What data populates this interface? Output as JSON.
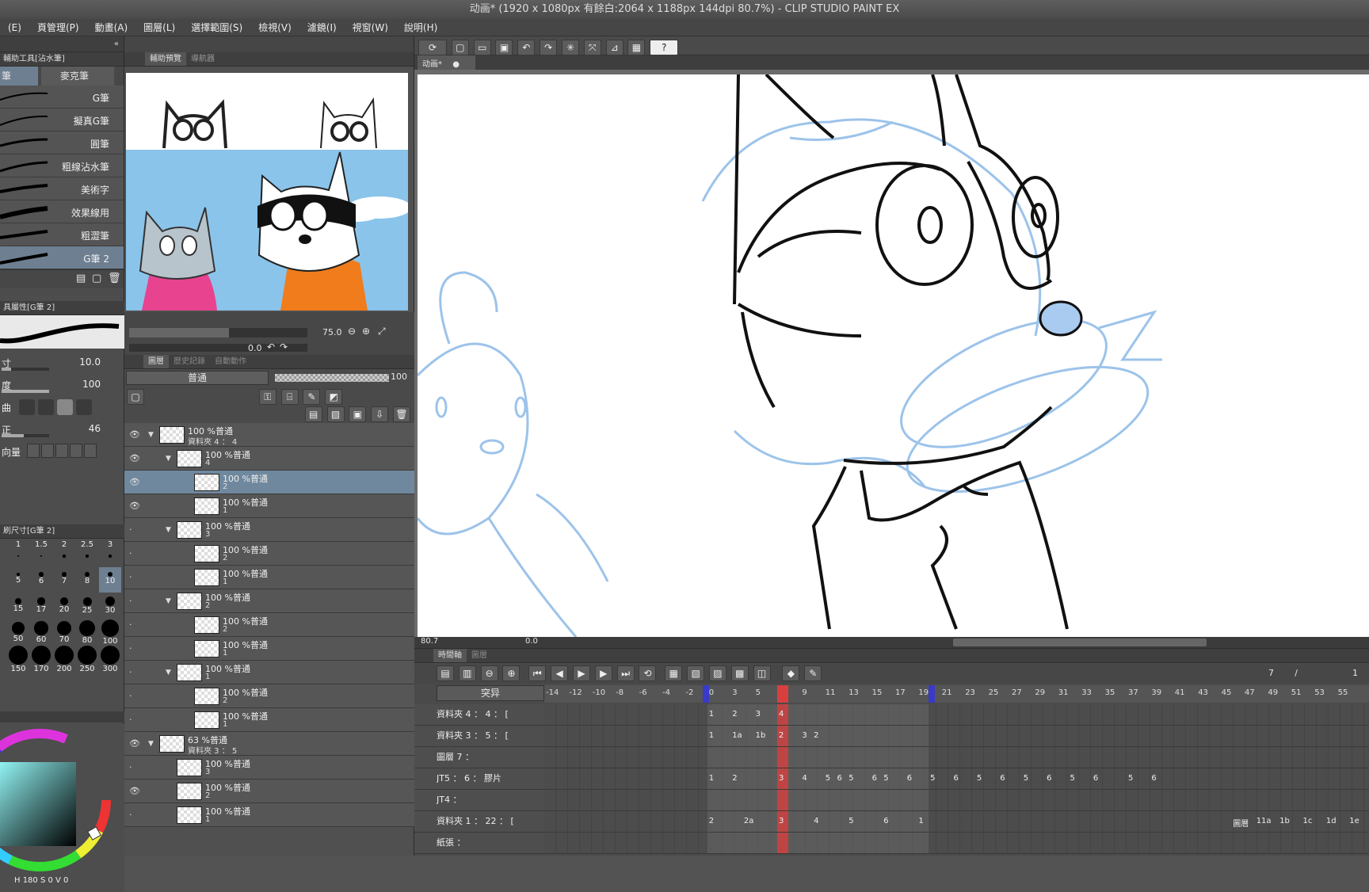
{
  "window": {
    "title": "动画* (1920 x 1080px 有餘白:2064 x 1188px 144dpi 80.7%)  - CLIP STUDIO PAINT EX"
  },
  "menu": [
    "(E)",
    "頁管理(P)",
    "動畫(A)",
    "圖層(L)",
    "選擇範圍(S)",
    "檢視(V)",
    "濾鏡(I)",
    "視窗(W)",
    "說明(H)"
  ],
  "subtool": {
    "panel_title": "輔助工具[沾水筆]",
    "tabs": [
      "筆",
      "麥克筆"
    ],
    "brushes": [
      "G筆",
      "擬真G筆",
      "圓筆",
      "粗線沾水筆",
      "美術字",
      "效果線用",
      "粗澀筆",
      "G筆 2"
    ],
    "selected_index": 7
  },
  "tool_property": {
    "title": "具屬性[G筆 2]",
    "size_label": "寸",
    "size_value": "10.0",
    "opacity_label": "度",
    "opacity_value": "100",
    "aa_label": "曲",
    "stab_label": "正",
    "stab_value": "46",
    "vector_label": "向量"
  },
  "brush_size": {
    "title": "刷尺寸[G筆 2]",
    "rows": [
      [
        "",
        "1",
        "1.5",
        "2",
        "2.5",
        "3"
      ],
      [
        "",
        "5",
        "6",
        "7",
        "8",
        "10"
      ],
      [
        "",
        "15",
        "17",
        "20",
        "25",
        "30"
      ],
      [
        "",
        "50",
        "60",
        "70",
        "80",
        "100"
      ],
      [
        "",
        "150",
        "170",
        "200",
        "250",
        "300"
      ]
    ],
    "selected": "10"
  },
  "color": {
    "hsv": "H 180 S 0 V 0"
  },
  "navigator": {
    "tabs": [
      "輔助預覽",
      "導航器"
    ],
    "zoom": "75.0",
    "rotate": "0.0"
  },
  "layers": {
    "tabs": [
      "圖層",
      "歷史記錄",
      "自動動作"
    ],
    "blend_mode": "普通",
    "opacity": "100",
    "rows": [
      {
        "t1": "100 %普通",
        "t2": "資料夾 4 ： 4",
        "depth": 0,
        "folder": true,
        "eye": true
      },
      {
        "t1": "100 %普通",
        "t2": "4",
        "depth": 1,
        "folder": true,
        "eye": true
      },
      {
        "t1": "100 %普通",
        "t2": "2",
        "depth": 2,
        "folder": false,
        "eye": true,
        "sel": true
      },
      {
        "t1": "100 %普通",
        "t2": "1",
        "depth": 2,
        "folder": false,
        "eye": true
      },
      {
        "t1": "100 %普通",
        "t2": "3",
        "depth": 1,
        "folder": true,
        "eye": false
      },
      {
        "t1": "100 %普通",
        "t2": "2",
        "depth": 2,
        "folder": false,
        "eye": false
      },
      {
        "t1": "100 %普通",
        "t2": "1",
        "depth": 2,
        "folder": false,
        "eye": false
      },
      {
        "t1": "100 %普通",
        "t2": "2",
        "depth": 1,
        "folder": true,
        "eye": false
      },
      {
        "t1": "100 %普通",
        "t2": "2",
        "depth": 2,
        "folder": false,
        "eye": false
      },
      {
        "t1": "100 %普通",
        "t2": "1",
        "depth": 2,
        "folder": false,
        "eye": false
      },
      {
        "t1": "100 %普通",
        "t2": "1",
        "depth": 1,
        "folder": true,
        "eye": false
      },
      {
        "t1": "100 %普通",
        "t2": "2",
        "depth": 2,
        "folder": false,
        "eye": false
      },
      {
        "t1": "100 %普通",
        "t2": "1",
        "depth": 2,
        "folder": false,
        "eye": false
      },
      {
        "t1": "63 %普通",
        "t2": "資料夾 3 ： 5",
        "depth": 0,
        "folder": true,
        "eye": true
      },
      {
        "t1": "100 %普通",
        "t2": "3",
        "depth": 1,
        "folder": false,
        "eye": false
      },
      {
        "t1": "100 %普通",
        "t2": "2",
        "depth": 1,
        "folder": false,
        "eye": true
      },
      {
        "t1": "100 %普通",
        "t2": "1",
        "depth": 1,
        "folder": false,
        "eye": false
      }
    ]
  },
  "canvas": {
    "tab": "动画*",
    "zoom": "80.7",
    "rotate": "0.0"
  },
  "timeline": {
    "tabs": [
      "時間軸",
      "圖層"
    ],
    "mode": "突异",
    "frame_counter": "7",
    "frame_total": "1",
    "ruler": [
      "-14",
      "-12",
      "-10",
      "-8",
      "-6",
      "-4",
      "-2",
      "0",
      "3",
      "5",
      "7",
      "9",
      "11",
      "13",
      "15",
      "17",
      "19",
      "21",
      "23",
      "25",
      "27",
      "29",
      "31",
      "33",
      "35",
      "37",
      "39",
      "41",
      "43",
      "45",
      "47",
      "49",
      "51",
      "53",
      "55"
    ],
    "tracks": [
      {
        "name": "資料夾 4 ： 4 ： [",
        "cells": [
          [
            "1",
            0
          ],
          [
            "2",
            2
          ],
          [
            "3",
            4
          ],
          [
            "4",
            6
          ]
        ]
      },
      {
        "name": "資料夾 3 ： 5 ： [",
        "cells": [
          [
            "1",
            0
          ],
          [
            "1a",
            2
          ],
          [
            "1b",
            4
          ],
          [
            "2",
            6
          ],
          [
            "3",
            8
          ],
          [
            "2",
            9
          ]
        ]
      },
      {
        "name": "圖層 7 ：",
        "cells": []
      },
      {
        "name": "JT5 ： 6 ： 膠片",
        "cells": [
          [
            "1",
            0
          ],
          [
            "2",
            2
          ],
          [
            "3",
            6
          ],
          [
            "4",
            8
          ],
          [
            "5",
            10
          ],
          [
            "6",
            11
          ],
          [
            "5",
            12
          ],
          [
            "6",
            14
          ],
          [
            "5",
            15
          ],
          [
            "6",
            17
          ],
          [
            "5",
            19
          ],
          [
            "6",
            21
          ],
          [
            "5",
            23
          ],
          [
            "6",
            25
          ],
          [
            "5",
            27
          ],
          [
            "6",
            29
          ],
          [
            "5",
            31
          ],
          [
            "6",
            33
          ],
          [
            "5",
            36
          ],
          [
            "6",
            38
          ]
        ]
      },
      {
        "name": "JT4 ：",
        "cells": []
      },
      {
        "name": "資料夾 1 ： 22 ： [",
        "cells": [
          [
            "2",
            0
          ],
          [
            "2a",
            3
          ],
          [
            "3",
            6
          ],
          [
            "4",
            9
          ],
          [
            "5",
            12
          ],
          [
            "6",
            15
          ],
          [
            "1",
            18
          ],
          [
            "圖層",
            45
          ],
          [
            "11a",
            47
          ],
          [
            "1b",
            49
          ],
          [
            "1c",
            51
          ],
          [
            "1d",
            53
          ],
          [
            "1e",
            55
          ]
        ]
      },
      {
        "name": "紙張 ：",
        "cells": []
      }
    ]
  }
}
